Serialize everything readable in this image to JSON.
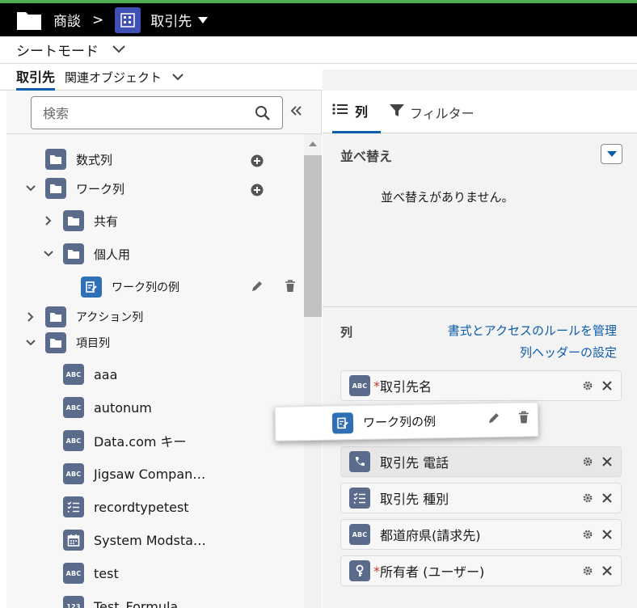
{
  "topbar": {
    "crumb": "商談",
    "separator": ">",
    "object_name": "取引先"
  },
  "mode": {
    "label": "シートモード"
  },
  "tabs": {
    "active": "取引先",
    "related": "関連オブジェクト"
  },
  "search": {
    "placeholder": "検索"
  },
  "tree": {
    "items": [
      {
        "label": "数式列"
      },
      {
        "label": "ワーク列"
      },
      {
        "label": "共有"
      },
      {
        "label": "個人用"
      },
      {
        "label": "ワーク列の例"
      },
      {
        "label": "アクション列"
      },
      {
        "label": "項目列"
      }
    ],
    "fields": [
      {
        "label": "aaa",
        "icon": "ABC"
      },
      {
        "label": "autonum",
        "icon": "ABC"
      },
      {
        "label": "Data.com キー",
        "icon": "ABC"
      },
      {
        "label": "Jigsaw Compan…",
        "icon": "ABC"
      },
      {
        "label": "recordtypetest",
        "icon": "list-icon"
      },
      {
        "label": "System Modsta…",
        "icon": "calendar-icon"
      },
      {
        "label": "test",
        "icon": "ABC"
      },
      {
        "label": "Test_Formula",
        "icon": "123"
      }
    ]
  },
  "right_tabs": {
    "columns": "列",
    "filter": "フィルター"
  },
  "sort": {
    "title": "並べ替え",
    "empty": "並べ替えがありません。"
  },
  "columns": {
    "title": "列",
    "link_rules": "書式とアクセスのルールを管理",
    "link_header": "列ヘッダーの設定",
    "items": [
      {
        "label": "取引先名",
        "icon": "ABC",
        "required": "*"
      },
      {
        "label": "取引先 電話",
        "icon": "phone-icon"
      },
      {
        "label": "取引先 種別",
        "icon": "list-icon"
      },
      {
        "label": "都道府県(請求先)",
        "icon": "ABC"
      },
      {
        "label": "所有者 (ユーザー)",
        "icon": "lookup-icon",
        "required": "*"
      }
    ]
  },
  "drag_card": {
    "label": "ワーク列の例"
  },
  "colors": {
    "accent": "#0b5cab",
    "icon_bg": "#5a6b8c",
    "work_icon": "#2e6fb5",
    "required": "#c23934"
  }
}
